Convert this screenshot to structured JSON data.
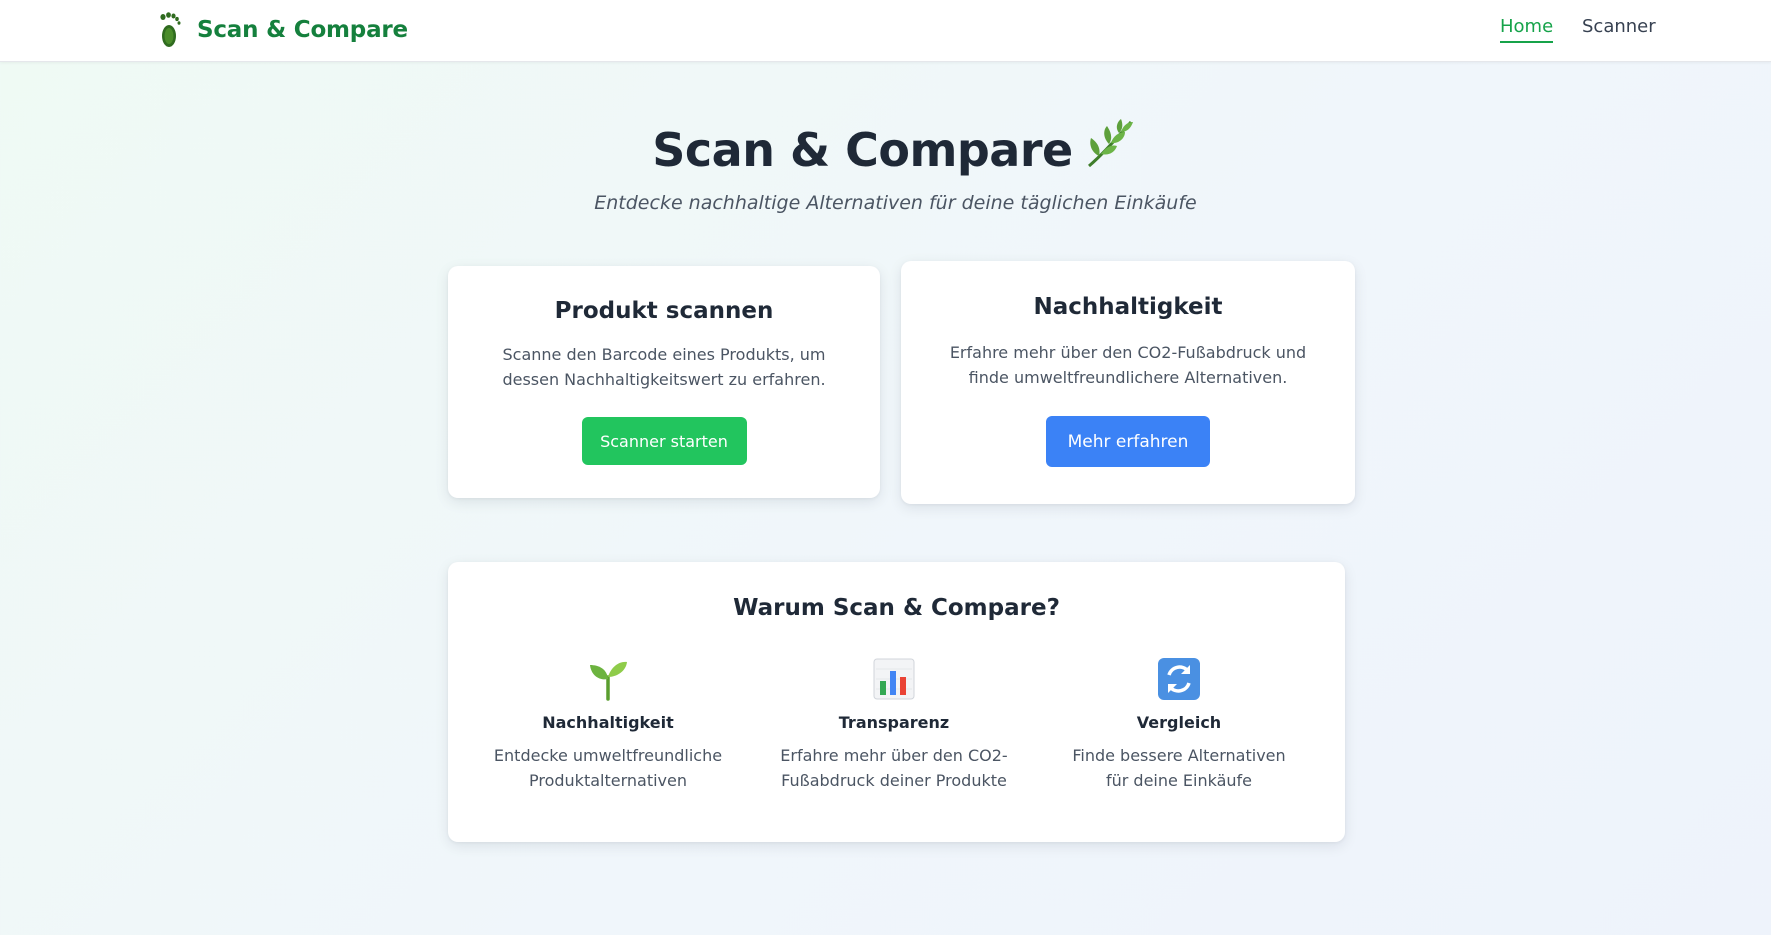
{
  "nav": {
    "brand": "Scan & Compare",
    "links": [
      {
        "label": "Home",
        "active": true
      },
      {
        "label": "Scanner",
        "active": false
      }
    ]
  },
  "hero": {
    "title": "Scan & Compare",
    "subtitle": "Entdecke nachhaltige Alternativen für deine täglichen Einkäufe",
    "title_icon": "leaf-icon"
  },
  "cards": {
    "scan": {
      "title": "Produkt scannen",
      "text": "Scanne den Barcode eines Produkts, um dessen Nachhaltigkeitswert zu erfahren.",
      "button": "Scanner starten"
    },
    "sustainability": {
      "title": "Nachhaltigkeit",
      "text": "Erfahre mehr über den CO2-Fußabdruck und finde umweltfreundlichere Alternativen.",
      "button": "Mehr erfahren"
    }
  },
  "why": {
    "title": "Warum Scan & Compare?",
    "features": [
      {
        "icon": "seedling-icon",
        "title": "Nachhaltigkeit",
        "text": "Entdecke umweltfreundliche Produktalternativen"
      },
      {
        "icon": "bar-chart-icon",
        "title": "Transparenz",
        "text": "Erfahre mehr über den CO2-Fußabdruck deiner Produkte"
      },
      {
        "icon": "refresh-arrows-icon",
        "title": "Vergleich",
        "text": "Finde bessere Alternativen für deine Einkäufe"
      }
    ]
  },
  "colors": {
    "brand_green": "#15803d",
    "button_green": "#22c55e",
    "button_blue": "#3b82f6"
  }
}
